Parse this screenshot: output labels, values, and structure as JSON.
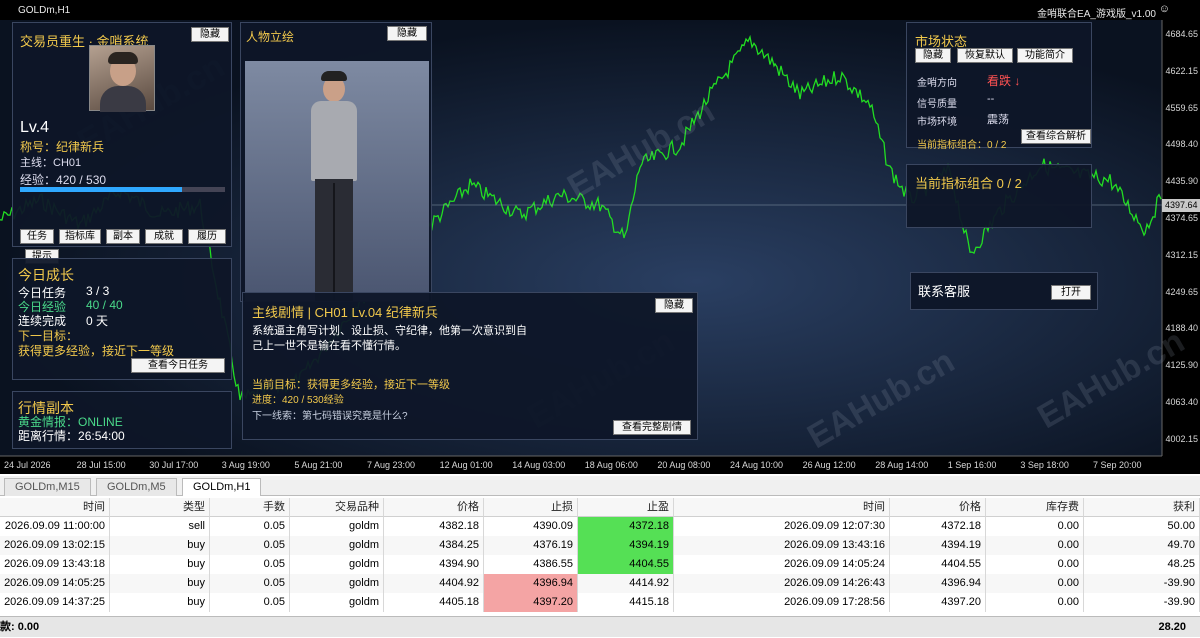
{
  "window": {
    "title": "GOLDm,H1",
    "ea_title": "金哨联合EA_游戏版_v1.00"
  },
  "chart": {
    "y_labels": [
      "4684.65",
      "4622.15",
      "4559.65",
      "4498.40",
      "4435.90",
      "4374.65",
      "4312.15",
      "4249.65",
      "4188.40",
      "4125.90",
      "4063.40",
      "4002.15"
    ],
    "x_labels": [
      "24 Jul 2026",
      "28 Jul 15:00",
      "30 Jul 17:00",
      "3 Aug 19:00",
      "5 Aug 21:00",
      "7 Aug 23:00",
      "12 Aug 01:00",
      "14 Aug 03:00",
      "18 Aug 06:00",
      "20 Aug 08:00",
      "24 Aug 10:00",
      "26 Aug 12:00",
      "28 Aug 14:00",
      "1 Sep 16:00",
      "3 Sep 18:00",
      "7 Sep 20:00"
    ],
    "current_price": "4397.64",
    "watermark": "EAHub.cn"
  },
  "profile": {
    "title": "交易员重生 · 金哨系统",
    "hide": "隐藏",
    "level": "Lv.4",
    "rank": "称号：纪律新兵",
    "mainline": "主线：CH01",
    "exp_label": "经验：",
    "exp_value": "420 / 530",
    "exp_fraction": 0.79,
    "buttons": [
      "任务",
      "指标库",
      "副本",
      "成就",
      "履历"
    ],
    "hint": "提示"
  },
  "portrait": {
    "title": "人物立绘",
    "hide": "隐藏"
  },
  "growth": {
    "title": "今日成长",
    "tasks_label": "今日任务",
    "tasks_value": "3 / 3",
    "exp_label": "今日经验",
    "exp_value": "40 / 40",
    "streak_label": "连续完成",
    "streak_value": "0 天",
    "next_label": "下一目标：",
    "next_value": "获得更多经验，接近下一等级",
    "button": "查看今日任务"
  },
  "dungeon": {
    "title": "行情副本",
    "intel_label": "黄金情报：",
    "intel_value": "ONLINE",
    "countdown_label": "距离行情：",
    "countdown_value": "26:54:00"
  },
  "story": {
    "title": "主线剧情 | CH01  Lv.04 纪律新兵",
    "hide": "隐藏",
    "line1": "系统逼主角写计划、设止损、守纪律，他第一次意识到自",
    "line2": "己上一世不是输在看不懂行情。",
    "goal": "当前目标：获得更多经验，接近下一等级",
    "progress": "进度：420 / 530经验",
    "clue": "下一线索：第七码错误究竟是什么?",
    "button": "查看完整剧情"
  },
  "market": {
    "title": "市场状态",
    "hide": "隐藏",
    "restore": "恢复默认",
    "intro": "功能简介",
    "dir_label": "金哨方向",
    "dir_value": "看跌 ↓",
    "qual_label": "信号质量",
    "qual_value": "--",
    "env_label": "市场环境",
    "env_value": "震荡",
    "combo_label": "当前指标组合：0 / 2",
    "analysis": "查看综合解析"
  },
  "combo": {
    "title": "当前指标组合  0 / 2"
  },
  "support": {
    "title": "联系客服",
    "open": "打开"
  },
  "tabs": [
    {
      "label": "GOLDm,M15"
    },
    {
      "label": "GOLDm,M5"
    },
    {
      "label": "GOLDm,H1"
    }
  ],
  "table": {
    "headers": [
      "时间",
      "类型",
      "手数",
      "交易品种",
      "价格",
      "止损",
      "止盈",
      "时间",
      "价格",
      "库存费",
      "获利"
    ],
    "rows": [
      [
        "2026.09.09 11:00:00",
        "sell",
        "0.05",
        "goldm",
        "4382.18",
        "4390.09",
        "4372.18",
        "2026.09.09 12:07:30",
        "4372.18",
        "0.00",
        "50.00"
      ],
      [
        "2026.09.09 13:02:15",
        "buy",
        "0.05",
        "goldm",
        "4384.25",
        "4376.19",
        "4394.19",
        "2026.09.09 13:43:16",
        "4394.19",
        "0.00",
        "49.70"
      ],
      [
        "2026.09.09 13:43:18",
        "buy",
        "0.05",
        "goldm",
        "4394.90",
        "4386.55",
        "4404.55",
        "2026.09.09 14:05:24",
        "4404.55",
        "0.00",
        "48.25"
      ],
      [
        "2026.09.09 14:05:25",
        "buy",
        "0.05",
        "goldm",
        "4404.92",
        "4396.94",
        "4414.92",
        "2026.09.09 14:26:43",
        "4396.94",
        "0.00",
        "-39.90"
      ],
      [
        "2026.09.09 14:37:25",
        "buy",
        "0.05",
        "goldm",
        "4405.18",
        "4397.20",
        "4415.18",
        "2026.09.09 17:28:56",
        "4397.20",
        "0.00",
        "-39.90"
      ]
    ],
    "balance_label": "款: 0.00",
    "total": "28.20"
  }
}
